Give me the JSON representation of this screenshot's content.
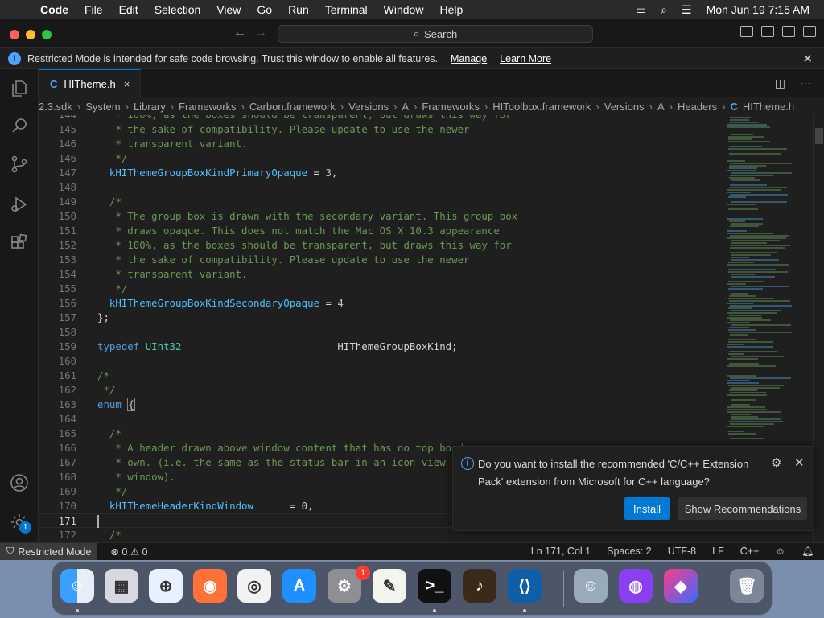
{
  "menubar": {
    "app": "Code",
    "items": [
      "File",
      "Edit",
      "Selection",
      "View",
      "Go",
      "Run",
      "Terminal",
      "Window",
      "Help"
    ],
    "clock": "Mon Jun 19  7:15 AM"
  },
  "titlebar": {
    "search_label": "Search"
  },
  "banner": {
    "text": "Restricted Mode is intended for safe code browsing. Trust this window to enable all features.",
    "manage": "Manage",
    "learn_more": "Learn More"
  },
  "tab": {
    "lang_icon": "C",
    "filename": "HITheme.h",
    "close": "×"
  },
  "breadcrumb": [
    "2.3.sdk",
    "System",
    "Library",
    "Frameworks",
    "Carbon.framework",
    "Versions",
    "A",
    "Frameworks",
    "HIToolbox.framework",
    "Versions",
    "A",
    "Headers",
    "HITheme.h"
  ],
  "breadcrumb_file_icon": "C",
  "editor": {
    "current_line": "171",
    "lines": [
      {
        "n": "144",
        "parts": [
          {
            "c": "cmt",
            "t": "   * 100%, as the boxes should be transparent, but draws this way for"
          }
        ]
      },
      {
        "n": "145",
        "parts": [
          {
            "c": "cmt",
            "t": "   * the sake of compatibility. Please update to use the newer"
          }
        ]
      },
      {
        "n": "146",
        "parts": [
          {
            "c": "cmt",
            "t": "   * transparent variant."
          }
        ]
      },
      {
        "n": "146b",
        "parts": [
          {
            "c": "cmt",
            "t": "   */"
          }
        ]
      },
      {
        "n": "147",
        "parts": [
          {
            "c": "id",
            "t": "  kHIThemeGroupBoxKindPrimaryOpaque"
          },
          {
            "c": "txt",
            "t": " = "
          },
          {
            "c": "num",
            "t": "3"
          },
          {
            "c": "txt",
            "t": ","
          }
        ]
      },
      {
        "n": "148",
        "parts": []
      },
      {
        "n": "149",
        "parts": [
          {
            "c": "cmt",
            "t": "  /*"
          }
        ]
      },
      {
        "n": "150",
        "parts": [
          {
            "c": "cmt",
            "t": "   * The group box is drawn with the secondary variant. This group box"
          }
        ]
      },
      {
        "n": "151",
        "parts": [
          {
            "c": "cmt",
            "t": "   * draws opaque. This does not match the Mac OS X 10.3 appearance"
          }
        ]
      },
      {
        "n": "152",
        "parts": [
          {
            "c": "cmt",
            "t": "   * 100%, as the boxes should be transparent, but draws this way for"
          }
        ]
      },
      {
        "n": "153",
        "parts": [
          {
            "c": "cmt",
            "t": "   * the sake of compatibility. Please update to use the newer"
          }
        ]
      },
      {
        "n": "154",
        "parts": [
          {
            "c": "cmt",
            "t": "   * transparent variant."
          }
        ]
      },
      {
        "n": "155",
        "parts": [
          {
            "c": "cmt",
            "t": "   */"
          }
        ]
      },
      {
        "n": "156",
        "parts": [
          {
            "c": "id",
            "t": "  kHIThemeGroupBoxKindSecondaryOpaque"
          },
          {
            "c": "txt",
            "t": " = "
          },
          {
            "c": "num",
            "t": "4"
          }
        ]
      },
      {
        "n": "157",
        "parts": [
          {
            "c": "txt",
            "t": "};"
          }
        ]
      },
      {
        "n": "158",
        "parts": []
      },
      {
        "n": "159",
        "parts": [
          {
            "c": "kw",
            "t": "typedef"
          },
          {
            "c": "txt",
            "t": " "
          },
          {
            "c": "ty",
            "t": "UInt32"
          },
          {
            "c": "txt",
            "t": "                          HIThemeGroupBoxKind;"
          }
        ]
      },
      {
        "n": "160",
        "parts": []
      },
      {
        "n": "161",
        "parts": [
          {
            "c": "cmt",
            "t": "/*"
          }
        ]
      },
      {
        "n": "162",
        "parts": [
          {
            "c": "cmt",
            "t": " */"
          }
        ]
      },
      {
        "n": "163",
        "parts": [
          {
            "c": "kw",
            "t": "enum"
          },
          {
            "c": "txt",
            "t": " "
          },
          {
            "c": "brk",
            "t": "{"
          }
        ]
      },
      {
        "n": "164",
        "parts": []
      },
      {
        "n": "165",
        "parts": [
          {
            "c": "cmt",
            "t": "  /*"
          }
        ]
      },
      {
        "n": "166",
        "parts": [
          {
            "c": "cmt",
            "t": "   * A header drawn above window content that has no top bord"
          }
        ]
      },
      {
        "n": "167",
        "parts": [
          {
            "c": "cmt",
            "t": "   * own. (i.e. the same as the status bar in an icon view Fi"
          }
        ]
      },
      {
        "n": "168",
        "parts": [
          {
            "c": "cmt",
            "t": "   * window)."
          }
        ]
      },
      {
        "n": "169",
        "parts": [
          {
            "c": "cmt",
            "t": "   */"
          }
        ]
      },
      {
        "n": "170",
        "parts": [
          {
            "c": "id",
            "t": "  kHIThemeHeaderKindWindow"
          },
          {
            "c": "txt",
            "t": "      = "
          },
          {
            "c": "num",
            "t": "0"
          },
          {
            "c": "txt",
            "t": ","
          }
        ]
      },
      {
        "n": "171",
        "parts": []
      },
      {
        "n": "172",
        "parts": [
          {
            "c": "cmt",
            "t": "  /*"
          }
        ]
      }
    ]
  },
  "notification": {
    "message": "Do you want to install the recommended 'C/C++ Extension Pack' extension from Microsoft for C++ language?",
    "install": "Install",
    "show_recommendations": "Show Recommendations"
  },
  "statusbar": {
    "restricted": "Restricted Mode",
    "errors": "0",
    "warnings": "0",
    "position": "Ln 171, Col 1",
    "spaces": "Spaces: 2",
    "encoding": "UTF-8",
    "eol": "LF",
    "language": "C++"
  },
  "activity": {
    "accounts_badge": "1"
  },
  "dock": {
    "apps": [
      "Finder",
      "Launchpad",
      "Safari",
      "Firefox",
      "Chrome",
      "App Store",
      "System Settings",
      "TextEdit",
      "Terminal",
      "GarageBand",
      "Visual Studio Code",
      "Migration Assistant",
      "Podcasts",
      "Shortcuts",
      "Trash"
    ],
    "settings_badge": "1",
    "colors": {
      "finder": "#2a8cf0",
      "safari": "#1e90ff",
      "firefox": "#ff7139",
      "vscode": "#007acc"
    }
  },
  "colors": {
    "accent": "#0078d4",
    "comment": "#6a9955",
    "identifier": "#4fc1ff",
    "keyword": "#569cd6"
  }
}
